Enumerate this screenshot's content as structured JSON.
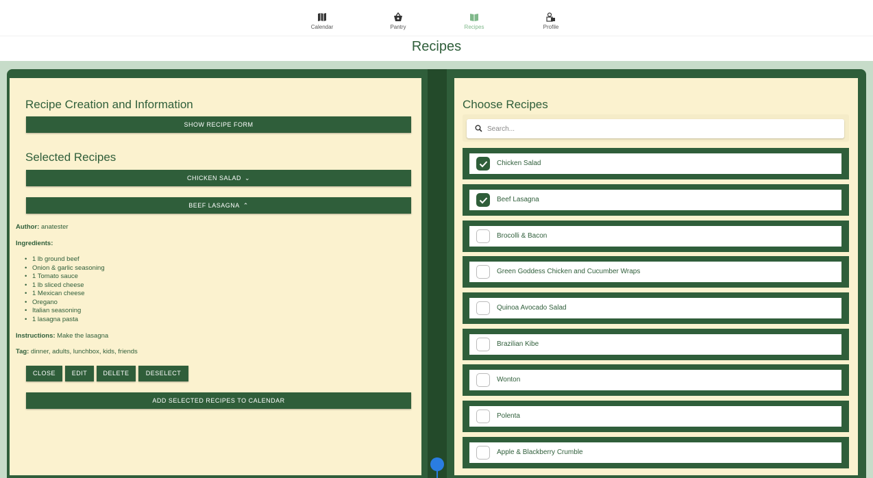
{
  "nav": {
    "items": [
      {
        "label": "Calendar",
        "icon": "map-icon"
      },
      {
        "label": "Pantry",
        "icon": "basket-icon"
      },
      {
        "label": "Recipes",
        "icon": "book-icon"
      },
      {
        "label": "Profile",
        "icon": "profile-icon"
      }
    ],
    "active": "Recipes"
  },
  "page_title": "Recipes",
  "left": {
    "heading": "Recipe Creation and Information",
    "show_form_label": "SHOW RECIPE FORM",
    "selected_heading": "Selected Recipes",
    "accordions": [
      {
        "label": "CHICKEN SALAD",
        "expanded": false
      },
      {
        "label": "BEEF LASAGNA",
        "expanded": true
      }
    ],
    "detail": {
      "author_label": "Author:",
      "author": "anatester",
      "ingredients_label": "Ingredients:",
      "ingredients": [
        "1 lb ground beef",
        "Onion & garlic seasoning",
        "1 Tomato sauce",
        "1 lb sliced cheese",
        "1 Mexican cheese",
        "Oregano",
        "Italian seasoning",
        "1 lasagna pasta"
      ],
      "instructions_label": "Instructions:",
      "instructions": "Make the lasagna",
      "tag_label": "Tag:",
      "tags": "dinner, adults, lunchbox, kids, friends"
    },
    "actions": {
      "close": "CLOSE",
      "edit": "EDIT",
      "delete": "DELETE",
      "deselect": "DESELECT"
    },
    "add_to_calendar_label": "ADD SELECTED RECIPES TO CALENDAR"
  },
  "right": {
    "heading": "Choose Recipes",
    "search_placeholder": "Search...",
    "recipes": [
      {
        "name": "Chicken Salad",
        "checked": true
      },
      {
        "name": "Beef Lasagna",
        "checked": true
      },
      {
        "name": "Brocolli & Bacon",
        "checked": false
      },
      {
        "name": "Green Goddess Chicken and Cucumber Wraps",
        "checked": false
      },
      {
        "name": "Quinoa Avocado Salad",
        "checked": false
      },
      {
        "name": "Brazilian Kibe",
        "checked": false
      },
      {
        "name": "Wonton",
        "checked": false
      },
      {
        "name": "Polenta",
        "checked": false
      },
      {
        "name": "Apple & Blackberry Crumble",
        "checked": false
      }
    ]
  },
  "colors": {
    "primary": "#2f5e3a",
    "page": "#fbf2cf",
    "spine": "#234a2a",
    "background": "#c7dcc9",
    "active_nav": "#7fb88a",
    "scroll_indicator": "#2a7de1"
  }
}
